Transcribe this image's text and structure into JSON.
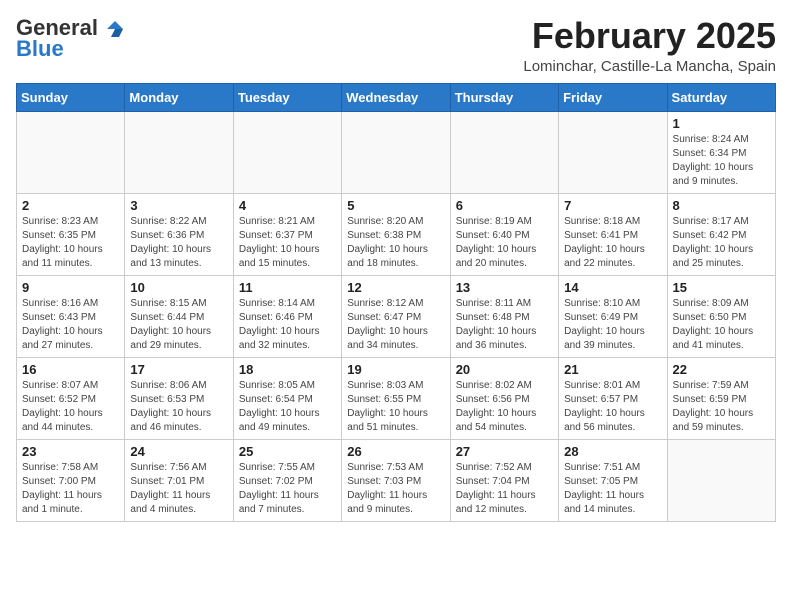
{
  "header": {
    "logo_general": "General",
    "logo_blue": "Blue",
    "month_year": "February 2025",
    "location": "Lominchar, Castille-La Mancha, Spain"
  },
  "weekdays": [
    "Sunday",
    "Monday",
    "Tuesday",
    "Wednesday",
    "Thursday",
    "Friday",
    "Saturday"
  ],
  "weeks": [
    [
      {
        "day": "",
        "info": ""
      },
      {
        "day": "",
        "info": ""
      },
      {
        "day": "",
        "info": ""
      },
      {
        "day": "",
        "info": ""
      },
      {
        "day": "",
        "info": ""
      },
      {
        "day": "",
        "info": ""
      },
      {
        "day": "1",
        "info": "Sunrise: 8:24 AM\nSunset: 6:34 PM\nDaylight: 10 hours and 9 minutes."
      }
    ],
    [
      {
        "day": "2",
        "info": "Sunrise: 8:23 AM\nSunset: 6:35 PM\nDaylight: 10 hours and 11 minutes."
      },
      {
        "day": "3",
        "info": "Sunrise: 8:22 AM\nSunset: 6:36 PM\nDaylight: 10 hours and 13 minutes."
      },
      {
        "day": "4",
        "info": "Sunrise: 8:21 AM\nSunset: 6:37 PM\nDaylight: 10 hours and 15 minutes."
      },
      {
        "day": "5",
        "info": "Sunrise: 8:20 AM\nSunset: 6:38 PM\nDaylight: 10 hours and 18 minutes."
      },
      {
        "day": "6",
        "info": "Sunrise: 8:19 AM\nSunset: 6:40 PM\nDaylight: 10 hours and 20 minutes."
      },
      {
        "day": "7",
        "info": "Sunrise: 8:18 AM\nSunset: 6:41 PM\nDaylight: 10 hours and 22 minutes."
      },
      {
        "day": "8",
        "info": "Sunrise: 8:17 AM\nSunset: 6:42 PM\nDaylight: 10 hours and 25 minutes."
      }
    ],
    [
      {
        "day": "9",
        "info": "Sunrise: 8:16 AM\nSunset: 6:43 PM\nDaylight: 10 hours and 27 minutes."
      },
      {
        "day": "10",
        "info": "Sunrise: 8:15 AM\nSunset: 6:44 PM\nDaylight: 10 hours and 29 minutes."
      },
      {
        "day": "11",
        "info": "Sunrise: 8:14 AM\nSunset: 6:46 PM\nDaylight: 10 hours and 32 minutes."
      },
      {
        "day": "12",
        "info": "Sunrise: 8:12 AM\nSunset: 6:47 PM\nDaylight: 10 hours and 34 minutes."
      },
      {
        "day": "13",
        "info": "Sunrise: 8:11 AM\nSunset: 6:48 PM\nDaylight: 10 hours and 36 minutes."
      },
      {
        "day": "14",
        "info": "Sunrise: 8:10 AM\nSunset: 6:49 PM\nDaylight: 10 hours and 39 minutes."
      },
      {
        "day": "15",
        "info": "Sunrise: 8:09 AM\nSunset: 6:50 PM\nDaylight: 10 hours and 41 minutes."
      }
    ],
    [
      {
        "day": "16",
        "info": "Sunrise: 8:07 AM\nSunset: 6:52 PM\nDaylight: 10 hours and 44 minutes."
      },
      {
        "day": "17",
        "info": "Sunrise: 8:06 AM\nSunset: 6:53 PM\nDaylight: 10 hours and 46 minutes."
      },
      {
        "day": "18",
        "info": "Sunrise: 8:05 AM\nSunset: 6:54 PM\nDaylight: 10 hours and 49 minutes."
      },
      {
        "day": "19",
        "info": "Sunrise: 8:03 AM\nSunset: 6:55 PM\nDaylight: 10 hours and 51 minutes."
      },
      {
        "day": "20",
        "info": "Sunrise: 8:02 AM\nSunset: 6:56 PM\nDaylight: 10 hours and 54 minutes."
      },
      {
        "day": "21",
        "info": "Sunrise: 8:01 AM\nSunset: 6:57 PM\nDaylight: 10 hours and 56 minutes."
      },
      {
        "day": "22",
        "info": "Sunrise: 7:59 AM\nSunset: 6:59 PM\nDaylight: 10 hours and 59 minutes."
      }
    ],
    [
      {
        "day": "23",
        "info": "Sunrise: 7:58 AM\nSunset: 7:00 PM\nDaylight: 11 hours and 1 minute."
      },
      {
        "day": "24",
        "info": "Sunrise: 7:56 AM\nSunset: 7:01 PM\nDaylight: 11 hours and 4 minutes."
      },
      {
        "day": "25",
        "info": "Sunrise: 7:55 AM\nSunset: 7:02 PM\nDaylight: 11 hours and 7 minutes."
      },
      {
        "day": "26",
        "info": "Sunrise: 7:53 AM\nSunset: 7:03 PM\nDaylight: 11 hours and 9 minutes."
      },
      {
        "day": "27",
        "info": "Sunrise: 7:52 AM\nSunset: 7:04 PM\nDaylight: 11 hours and 12 minutes."
      },
      {
        "day": "28",
        "info": "Sunrise: 7:51 AM\nSunset: 7:05 PM\nDaylight: 11 hours and 14 minutes."
      },
      {
        "day": "",
        "info": ""
      }
    ]
  ]
}
